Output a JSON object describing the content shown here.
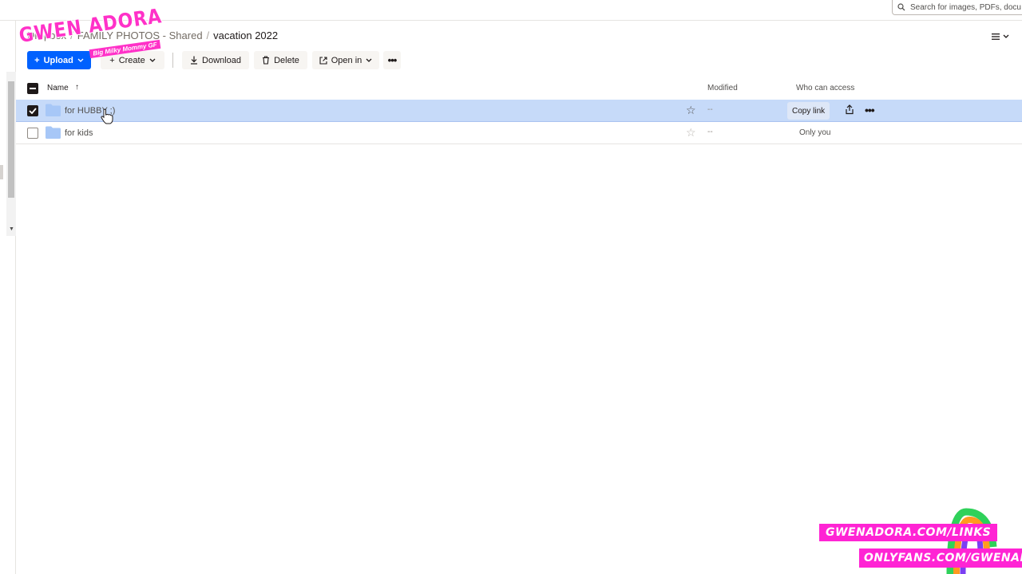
{
  "search": {
    "placeholder": "Search for images, PDFs, docu"
  },
  "breadcrumb": {
    "items": [
      "Dropbox",
      "FAMILY PHOTOS - Shared"
    ],
    "current": "vacation 2022"
  },
  "toolbar": {
    "upload_label": "Upload",
    "create_label": "Create",
    "download_label": "Download",
    "delete_label": "Delete",
    "open_in_label": "Open in"
  },
  "watermark": {
    "title": "GWEN ADORA",
    "subtitle": "Big Milky Mommy GF"
  },
  "table": {
    "columns": {
      "name": "Name",
      "modified": "Modified",
      "access": "Who can access"
    },
    "rows": [
      {
        "name": "for HUBBY ;)",
        "modified": "--",
        "access": "",
        "selected": true,
        "action": "Copy link"
      },
      {
        "name": "for kids",
        "modified": "--",
        "access": "Only you",
        "selected": false
      }
    ]
  },
  "promo": {
    "line1": "GWENADORA.COM/LINKS",
    "line2": "ONLYFANS.COM/GWENADORA"
  },
  "colors": {
    "accent": "#0061fe",
    "selected_row": "#c6daf9",
    "folder": "#a7c7f7",
    "promo_pink": "#ff24d4"
  }
}
